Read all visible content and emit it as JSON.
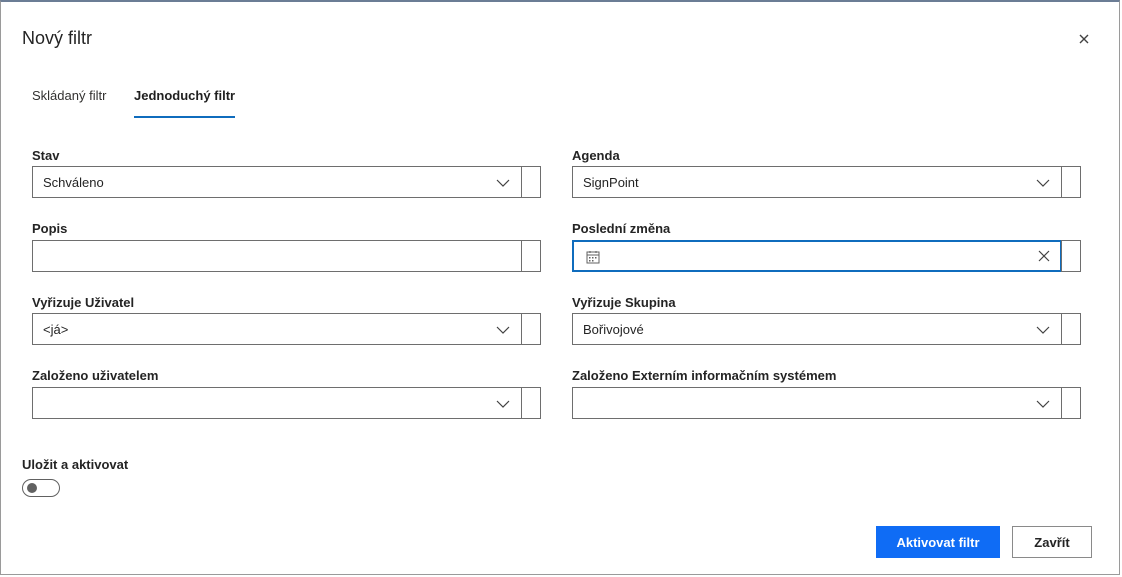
{
  "dialog": {
    "title": "Nový filtr"
  },
  "tabs": [
    {
      "label": "Skládaný filtr",
      "active": false
    },
    {
      "label": "Jednoduchý filtr",
      "active": true
    }
  ],
  "fields": {
    "stav": {
      "label": "Stav",
      "value": "Schváleno",
      "control": "dropdown"
    },
    "agenda": {
      "label": "Agenda",
      "value": "SignPoint",
      "control": "dropdown"
    },
    "popis": {
      "label": "Popis",
      "value": "",
      "control": "text"
    },
    "posledni_zmena": {
      "label": "Poslední změna",
      "value": "",
      "control": "date"
    },
    "vyrizuje_uzivatel": {
      "label": "Vyřizuje Uživatel",
      "value": "<já>",
      "control": "dropdown"
    },
    "vyrizuje_skupina": {
      "label": "Vyřizuje Skupina",
      "value": "Bořivojové",
      "control": "dropdown"
    },
    "zalozeno_uzivatelem": {
      "label": "Založeno uživatelem",
      "value": "",
      "control": "dropdown"
    },
    "zalozeno_externim": {
      "label": "Založeno Externím informačním systémem",
      "value": "",
      "control": "dropdown"
    }
  },
  "save_toggle": {
    "label": "Uložit a aktivovat",
    "on": false
  },
  "buttons": {
    "activate": "Aktivovat filtr",
    "close": "Zavřít"
  },
  "colors": {
    "accent": "#0f6cbd",
    "primary_button": "#0f6cf5",
    "border": "#6e6e6e"
  },
  "icons": {
    "close": "close-icon",
    "dropdown": "chevron-down-icon",
    "calendar": "calendar-icon",
    "clear": "clear-icon"
  }
}
